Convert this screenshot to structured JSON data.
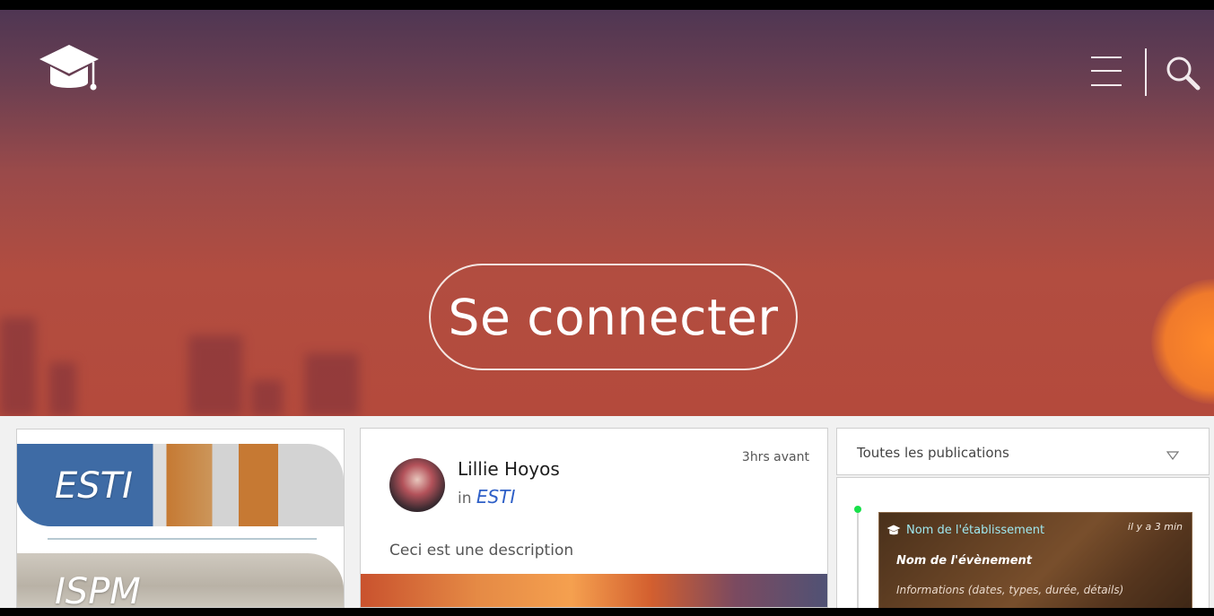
{
  "header": {
    "logo_icon": "graduation-cap-icon",
    "menu_icon": "hamburger-menu-icon",
    "search_icon": "search-icon",
    "login_label": "Se connecter"
  },
  "schools": {
    "items": [
      {
        "name": "ESTI",
        "color": "#1f5aa6"
      },
      {
        "name": "ISPM",
        "color": "#d9d5cd"
      }
    ]
  },
  "post": {
    "author": "Lillie Hoyos",
    "in_prefix": "in",
    "group": "ESTI",
    "time": "3hrs avant",
    "description": "Ceci est une description"
  },
  "feed": {
    "filter_label": "Toutes les publications",
    "filter_icon": "chevron-down-icon",
    "event": {
      "school": "Nom de l'établissement",
      "time": "il y a 3 min",
      "name": "Nom de l'évènement",
      "info": "Informations (dates, types, durée, détails)",
      "dot_color": "#18e04a"
    }
  }
}
